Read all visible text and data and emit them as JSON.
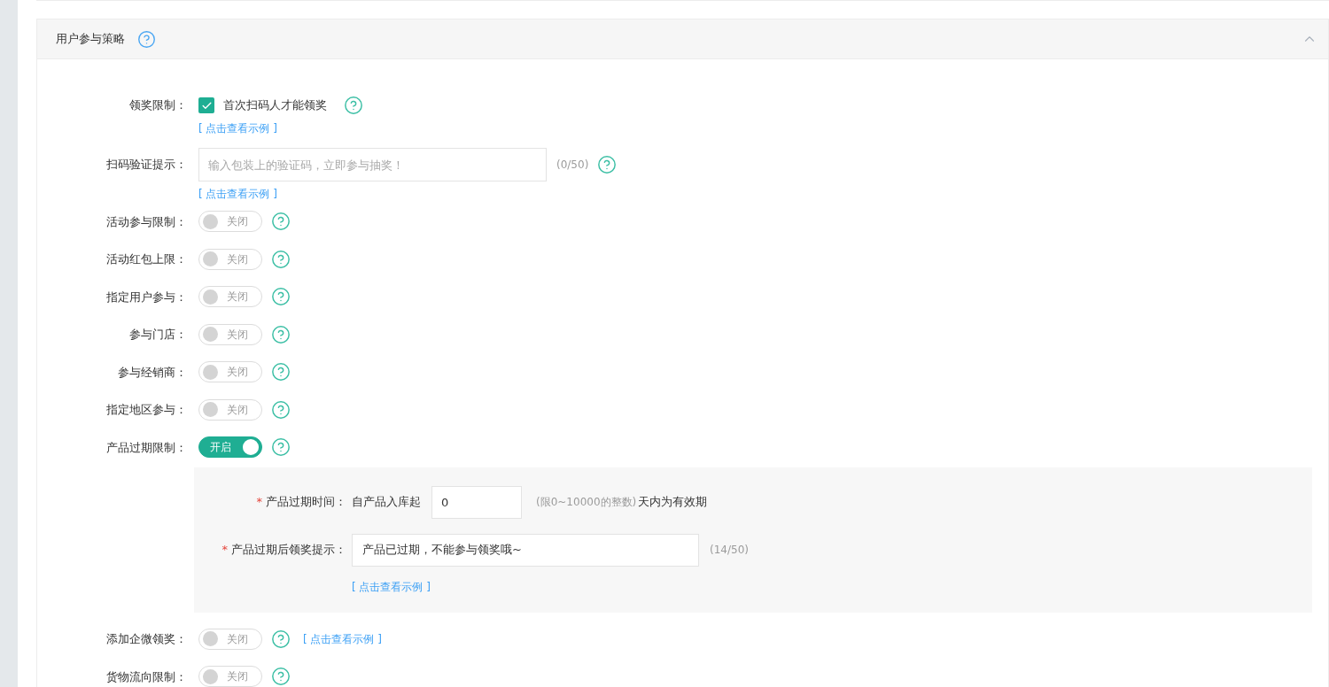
{
  "section": {
    "title": "用户参与策略",
    "expanded": true
  },
  "fields": [
    {
      "kind": "checkbox",
      "label": "领奖限制：",
      "checked": true,
      "text": "首次扫码人才能领奖",
      "link": "[ 点击查看示例 ]"
    },
    {
      "kind": "input",
      "label": "扫码验证提示：",
      "placeholder": "输入包装上的验证码，立即参与抽奖！",
      "counter": "(0/50)",
      "link": "[ 点击查看示例 ]"
    },
    {
      "kind": "switch",
      "label": "活动参与限制：",
      "on": false,
      "state_text": "关闭"
    },
    {
      "kind": "switch",
      "label": "活动红包上限：",
      "on": false,
      "state_text": "关闭"
    },
    {
      "kind": "switch",
      "label": "指定用户参与：",
      "on": false,
      "state_text": "关闭"
    },
    {
      "kind": "switch",
      "label": "参与门店：",
      "on": false,
      "state_text": "关闭"
    },
    {
      "kind": "switch",
      "label": "参与经销商：",
      "on": false,
      "state_text": "关闭"
    },
    {
      "kind": "switch",
      "label": "指定地区参与：",
      "on": false,
      "state_text": "关闭"
    },
    {
      "kind": "switch",
      "label": "产品过期限制：",
      "on": true,
      "state_text": "开启",
      "panel": [
        {
          "kind": "days",
          "required": "*",
          "label": "产品过期时间：",
          "prefix": "自产品入库起",
          "value": "0",
          "hint": "(限0~10000的整数)",
          "suffix": "天内为有效期"
        },
        {
          "kind": "text",
          "required": "*",
          "label": "产品过期后领奖提示：",
          "value": "产品已过期，不能参与领奖哦~",
          "counter": "(14/50)",
          "link": "[ 点击查看示例 ]"
        }
      ]
    },
    {
      "kind": "switch",
      "label": "添加企微领奖：",
      "on": false,
      "state_text": "关闭",
      "link": "[ 点击查看示例 ]"
    },
    {
      "kind": "switch",
      "label": "货物流向限制：",
      "on": false,
      "state_text": "关闭"
    }
  ]
}
